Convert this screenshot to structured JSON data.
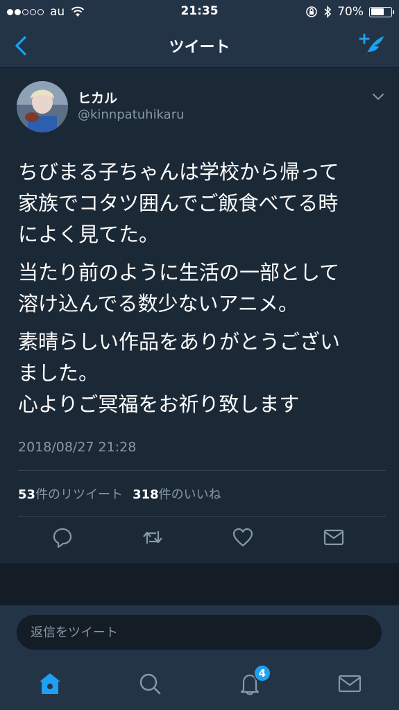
{
  "status_bar": {
    "carrier": "au",
    "time": "21:35",
    "battery": "70%",
    "battery_level": 0.7,
    "signal_bars_filled": 2,
    "signal_bars_total": 5
  },
  "nav": {
    "title": "ツイート",
    "back_icon": "chevron-left-icon",
    "compose_icon": "compose-tweet-icon"
  },
  "tweet": {
    "author_name": "ヒカル",
    "author_handle": "@kinnpatuhikaru",
    "paragraphs": [
      "ちびまる子ちゃんは学校から帰って\n家族でコタツ囲んでご飯食べてる時\nによく見てた。",
      "当たり前のように生活の一部として\n溶け込んでる数少ないアニメ。",
      "素晴らしい作品をありがとうござい\nました。\n心よりご冥福をお祈り致します"
    ],
    "timestamp": "2018/08/27 21:28",
    "retweet_count": "53",
    "retweet_label": "件のリツイート",
    "like_count": "318",
    "like_label": "件のいいね"
  },
  "reply": {
    "placeholder": "返信をツイート"
  },
  "tabbar": {
    "notifications_badge": "4"
  },
  "colors": {
    "accent": "#1da1f2",
    "background": "#1b2836",
    "bar": "#243447",
    "secondary_text": "#8899a6"
  }
}
